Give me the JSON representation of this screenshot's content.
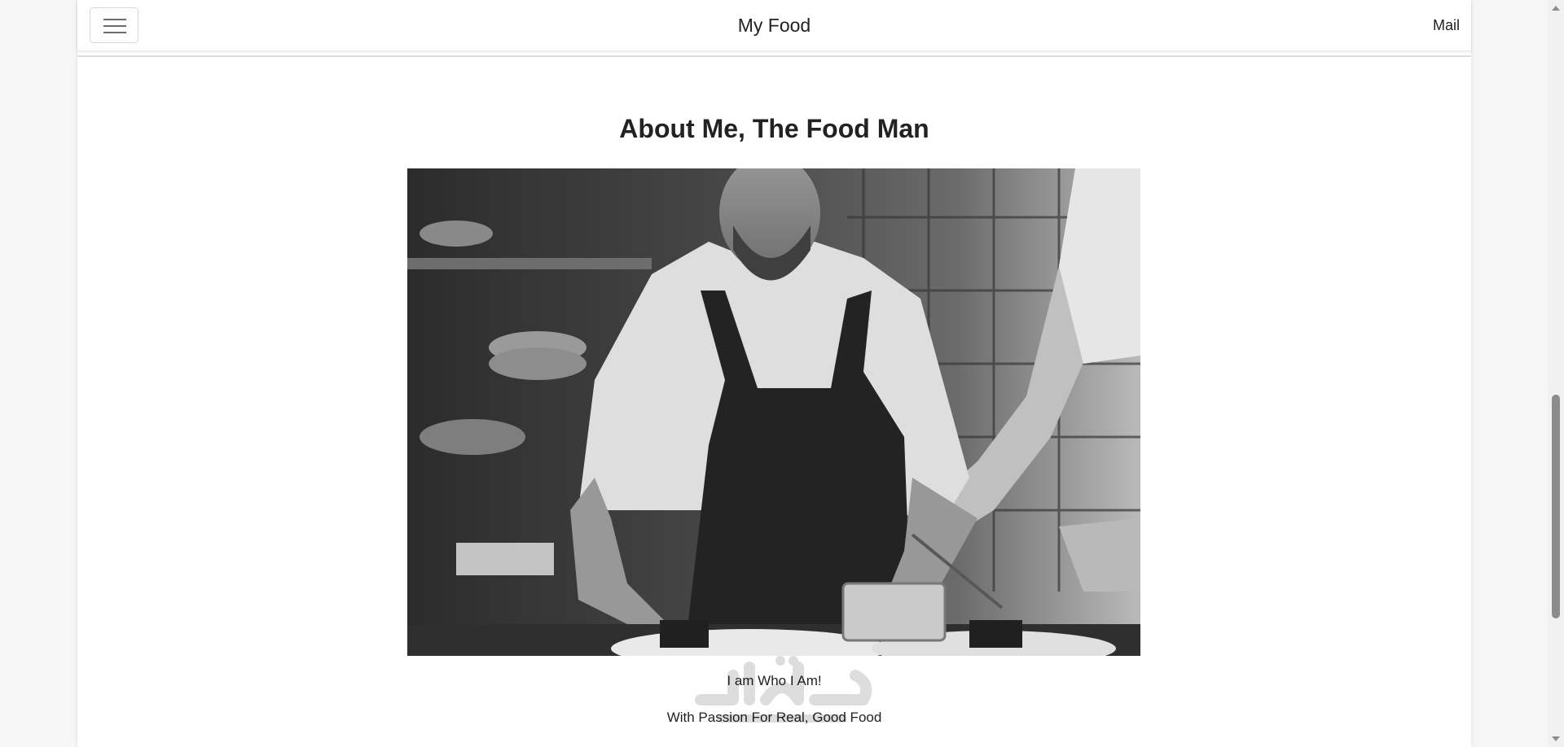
{
  "navbar": {
    "brand": "My Food",
    "mail_link": "Mail",
    "menu_icon": "hamburger-menu-icon"
  },
  "about": {
    "heading": "About Me, The Food Man",
    "photo_subject": "chef-plating-food-photo",
    "caption_line1": "I am Who I Am!",
    "caption_line2": "With Passion For Real, Good Food"
  },
  "watermark": {
    "logo": "mostaql-logo"
  },
  "colors": {
    "background": "#ffffff",
    "text": "#222222",
    "border": "#dedede"
  }
}
